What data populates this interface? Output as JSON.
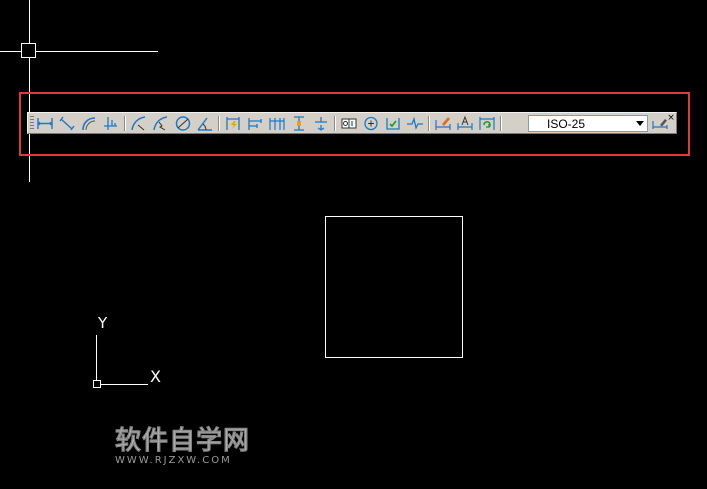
{
  "toolbar": {
    "name": "dimension-toolbar",
    "dim_style_value": "ISO-25",
    "close_glyph": "×",
    "accent_color": "#1f78c8",
    "buttons": [
      {
        "name": "linear-dimension-button",
        "icon": "linear-dimension-icon"
      },
      {
        "name": "aligned-dimension-button",
        "icon": "aligned-dimension-icon"
      },
      {
        "name": "arc-length-button",
        "icon": "arc-length-icon"
      },
      {
        "name": "ordinate-dimension-button",
        "icon": "ordinate-dimension-icon"
      },
      {
        "name": "radius-dimension-button",
        "icon": "radius-dimension-icon"
      },
      {
        "name": "jogged-radius-button",
        "icon": "jogged-radius-icon"
      },
      {
        "name": "diameter-dimension-button",
        "icon": "diameter-dimension-icon"
      },
      {
        "name": "angular-dimension-button",
        "icon": "angular-dimension-icon"
      },
      {
        "name": "quick-dimension-button",
        "icon": "quick-dimension-icon"
      },
      {
        "name": "baseline-dimension-button",
        "icon": "baseline-dimension-icon"
      },
      {
        "name": "continue-dimension-button",
        "icon": "continue-dimension-icon"
      },
      {
        "name": "dimension-space-button",
        "icon": "dimension-space-icon"
      },
      {
        "name": "dimension-break-button",
        "icon": "dimension-break-icon"
      },
      {
        "name": "tolerance-button",
        "icon": "tolerance-icon"
      },
      {
        "name": "center-mark-button",
        "icon": "center-mark-icon"
      },
      {
        "name": "inspection-button",
        "icon": "inspection-icon"
      },
      {
        "name": "jogged-linear-button",
        "icon": "jogged-linear-icon"
      },
      {
        "name": "dimension-edit-button",
        "icon": "dimension-edit-icon"
      },
      {
        "name": "dimension-text-edit-button",
        "icon": "dimension-text-edit-icon"
      },
      {
        "name": "dimension-update-button",
        "icon": "dimension-update-icon"
      },
      {
        "name": "dimension-style-button",
        "icon": "dimension-style-icon"
      }
    ]
  },
  "ucs": {
    "x_label": "X",
    "y_label": "Y"
  },
  "watermark": {
    "main": "软件自学网",
    "sub": "WWW.RJZXW.COM"
  },
  "colors": {
    "background": "#000000",
    "highlight": "#e0393e",
    "toolbar_bg": "#d4d0c8"
  }
}
